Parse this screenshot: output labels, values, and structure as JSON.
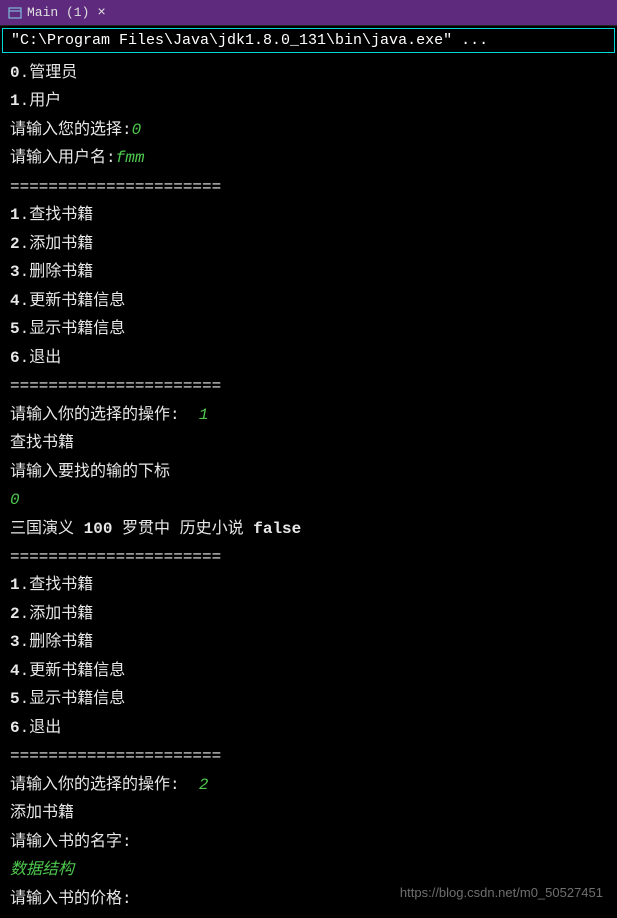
{
  "tab": {
    "title": "Main (1)"
  },
  "command": "\"C:\\Program Files\\Java\\jdk1.8.0_131\\bin\\java.exe\" ...",
  "lines": [
    {
      "parts": [
        {
          "text": "0",
          "cls": "bold-num"
        },
        {
          "text": ".管理员"
        }
      ]
    },
    {
      "parts": [
        {
          "text": "1",
          "cls": "bold-num"
        },
        {
          "text": ".用户"
        }
      ]
    },
    {
      "parts": [
        {
          "text": "请输入您的选择:"
        },
        {
          "text": "0",
          "cls": "input-green"
        }
      ]
    },
    {
      "parts": [
        {
          "text": "请输入用户名:"
        },
        {
          "text": "fmm",
          "cls": "input-green"
        }
      ]
    },
    {
      "parts": [
        {
          "text": "======================"
        }
      ]
    },
    {
      "parts": [
        {
          "text": "1",
          "cls": "bold-num"
        },
        {
          "text": ".查找书籍"
        }
      ]
    },
    {
      "parts": [
        {
          "text": "2",
          "cls": "bold-num"
        },
        {
          "text": ".添加书籍"
        }
      ]
    },
    {
      "parts": [
        {
          "text": "3",
          "cls": "bold-num"
        },
        {
          "text": ".删除书籍"
        }
      ]
    },
    {
      "parts": [
        {
          "text": "4",
          "cls": "bold-num"
        },
        {
          "text": ".更新书籍信息"
        }
      ]
    },
    {
      "parts": [
        {
          "text": "5",
          "cls": "bold-num"
        },
        {
          "text": ".显示书籍信息"
        }
      ]
    },
    {
      "parts": [
        {
          "text": "6",
          "cls": "bold-num"
        },
        {
          "text": ".退出"
        }
      ]
    },
    {
      "parts": [
        {
          "text": "======================"
        }
      ]
    },
    {
      "parts": [
        {
          "text": "请输入你的选择的操作:  "
        },
        {
          "text": "1",
          "cls": "input-green"
        }
      ]
    },
    {
      "parts": [
        {
          "text": "查找书籍"
        }
      ]
    },
    {
      "parts": [
        {
          "text": "请输入要找的输的下标"
        }
      ]
    },
    {
      "parts": [
        {
          "text": "0",
          "cls": "input-green"
        }
      ]
    },
    {
      "parts": [
        {
          "text": "三国演义 "
        },
        {
          "text": "100",
          "cls": "bold-num"
        },
        {
          "text": " 罗贯中 历史小说 "
        },
        {
          "text": "false",
          "cls": "bold-num"
        }
      ]
    },
    {
      "parts": [
        {
          "text": "======================"
        }
      ]
    },
    {
      "parts": [
        {
          "text": "1",
          "cls": "bold-num"
        },
        {
          "text": ".查找书籍"
        }
      ]
    },
    {
      "parts": [
        {
          "text": "2",
          "cls": "bold-num"
        },
        {
          "text": ".添加书籍"
        }
      ]
    },
    {
      "parts": [
        {
          "text": "3",
          "cls": "bold-num"
        },
        {
          "text": ".删除书籍"
        }
      ]
    },
    {
      "parts": [
        {
          "text": "4",
          "cls": "bold-num"
        },
        {
          "text": ".更新书籍信息"
        }
      ]
    },
    {
      "parts": [
        {
          "text": "5",
          "cls": "bold-num"
        },
        {
          "text": ".显示书籍信息"
        }
      ]
    },
    {
      "parts": [
        {
          "text": "6",
          "cls": "bold-num"
        },
        {
          "text": ".退出"
        }
      ]
    },
    {
      "parts": [
        {
          "text": "======================"
        }
      ]
    },
    {
      "parts": [
        {
          "text": "请输入你的选择的操作:  "
        },
        {
          "text": "2",
          "cls": "input-green"
        }
      ]
    },
    {
      "parts": [
        {
          "text": "添加书籍"
        }
      ]
    },
    {
      "parts": [
        {
          "text": "请输入书的名字:"
        }
      ]
    },
    {
      "parts": [
        {
          "text": "数据结构",
          "cls": "input-green"
        }
      ]
    },
    {
      "parts": [
        {
          "text": "请输入书的价格:"
        }
      ]
    }
  ],
  "watermark": "https://blog.csdn.net/m0_50527451"
}
